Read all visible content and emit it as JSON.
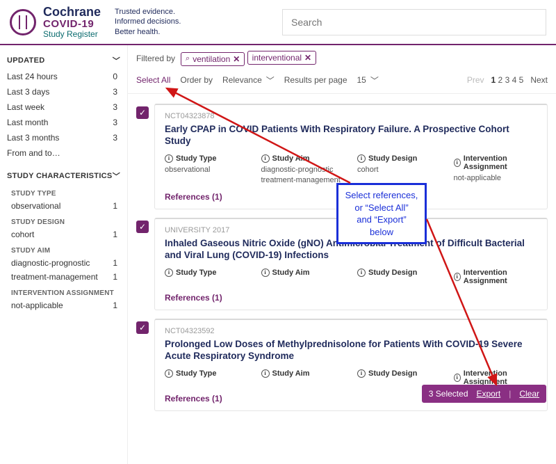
{
  "header": {
    "brand1": "Cochrane",
    "brand2": "COVID-19",
    "brand3": "Study Register",
    "tagline1": "Trusted evidence.",
    "tagline2": "Informed decisions.",
    "tagline3": "Better health.",
    "search_placeholder": "Search"
  },
  "sidebar": {
    "updated_hdr": "UPDATED",
    "updated": [
      {
        "label": "Last 24 hours",
        "n": "0"
      },
      {
        "label": "Last 3 days",
        "n": "3"
      },
      {
        "label": "Last week",
        "n": "3"
      },
      {
        "label": "Last month",
        "n": "3"
      },
      {
        "label": "Last 3 months",
        "n": "3"
      },
      {
        "label": "From and to…",
        "n": ""
      }
    ],
    "chars_hdr": "STUDY CHARACTERISTICS",
    "type_hdr": "STUDY TYPE",
    "type": [
      {
        "label": "observational",
        "n": "1"
      }
    ],
    "design_hdr": "STUDY DESIGN",
    "design": [
      {
        "label": "cohort",
        "n": "1"
      }
    ],
    "aim_hdr": "STUDY AIM",
    "aim": [
      {
        "label": "diagnostic-prognostic",
        "n": "1"
      },
      {
        "label": "treatment-management",
        "n": "1"
      }
    ],
    "intassign_hdr": "INTERVENTION ASSIGNMENT",
    "intassign": [
      {
        "label": "not-applicable",
        "n": "1"
      }
    ]
  },
  "filters": {
    "label": "Filtered by",
    "chips": [
      {
        "text": "ventilation",
        "search": true
      },
      {
        "text": "interventional",
        "search": false
      }
    ]
  },
  "controls": {
    "select_all": "Select All",
    "order_by": "Order by",
    "relevance": "Relevance",
    "rpp": "Results per page",
    "rpp_val": "15",
    "prev": "Prev",
    "next": "Next",
    "pages": [
      "1",
      "2",
      "3",
      "4",
      "5"
    ]
  },
  "meta_labels": {
    "type": "Study Type",
    "aim": "Study Aim",
    "design": "Study Design",
    "assign": "Intervention Assignment"
  },
  "results": [
    {
      "id": "NCT04323878",
      "title": "Early CPAP in COVID Patients With Respiratory Failure. A Prospective Cohort Study",
      "type": "observational",
      "aim": "diagnostic-prognostic\ntreatment-management",
      "design": "cohort",
      "assign": "not-applicable",
      "refs": "References (1)"
    },
    {
      "id": "UNIVERSITY 2017",
      "title": "Inhaled Gaseous Nitric Oxide (gNO) Antimicrobial Treatment of Difficult Bacterial and Viral Lung (COVID-19) Infections",
      "type": "",
      "aim": "",
      "design": "",
      "assign": "",
      "refs": "References (1)"
    },
    {
      "id": "NCT04323592",
      "title": "Prolonged Low Doses of Methylprednisolone for Patients With COVID-19 Severe Acute Respiratory Syndrome",
      "type": "",
      "aim": "",
      "design": "",
      "assign": "",
      "refs": "References (1)"
    }
  ],
  "callout": {
    "l1": "Select references,",
    "l2": "or “Select All”",
    "l3": "and “Export”",
    "l4": "below"
  },
  "footer": {
    "selected": "3 Selected",
    "export": "Export",
    "clear": "Clear"
  }
}
